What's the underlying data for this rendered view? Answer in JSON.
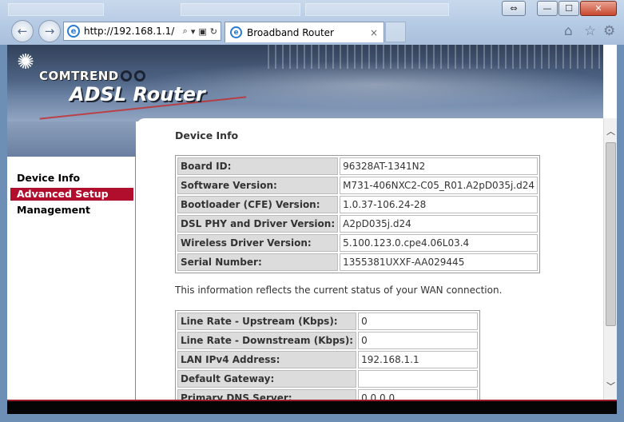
{
  "browser": {
    "url": "http://192.168.1.1/",
    "tab_title": "Broadband Router",
    "tab_close": "×",
    "back_glyph": "←",
    "forward_glyph": "→",
    "search_glyph": "⌕",
    "dropdown_glyph": "▾",
    "refresh_glyph": "↻",
    "compat_glyph": "▣",
    "home_glyph": "⌂",
    "favorites_glyph": "☆",
    "tools_glyph": "⚙",
    "window_buttons": {
      "restore": "⇔",
      "minimize": "—",
      "maximize": "☐",
      "close": "✕"
    }
  },
  "header": {
    "brand": "COMTREND",
    "product": "ADSL Router",
    "logo_glyph": "✺"
  },
  "sidebar": {
    "items": [
      {
        "label": "Device Info",
        "active": false
      },
      {
        "label": "Advanced Setup",
        "active": true
      },
      {
        "label": "Management",
        "active": false
      }
    ]
  },
  "main": {
    "title": "Device Info",
    "device_table": [
      {
        "key": "Board ID:",
        "value": "96328AT-1341N2"
      },
      {
        "key": "Software Version:",
        "value": "M731-406NXC2-C05_R01.A2pD035j.d24"
      },
      {
        "key": "Bootloader (CFE) Version:",
        "value": "1.0.37-106.24-28"
      },
      {
        "key": "DSL PHY and Driver Version:",
        "value": "A2pD035j.d24"
      },
      {
        "key": "Wireless Driver Version:",
        "value": "5.100.123.0.cpe4.06L03.4"
      },
      {
        "key": "Serial Number:",
        "value": "1355381UXXF-AA029445"
      }
    ],
    "note": "This information reflects the current status of your WAN connection.",
    "wan_table": [
      {
        "key": "Line Rate - Upstream (Kbps):",
        "value": "0"
      },
      {
        "key": "Line Rate - Downstream (Kbps):",
        "value": "0"
      },
      {
        "key": "LAN IPv4 Address:",
        "value": "192.168.1.1"
      },
      {
        "key": "Default Gateway:",
        "value": ""
      },
      {
        "key": "Primary DNS Server:",
        "value": "0.0.0.0"
      }
    ]
  },
  "scrollbar": {
    "up_glyph": "︿",
    "down_glyph": "﹀"
  },
  "colors": {
    "accent": "#b10d2c",
    "header": "#4d6384",
    "table_key_bg": "#dcdcdc"
  }
}
